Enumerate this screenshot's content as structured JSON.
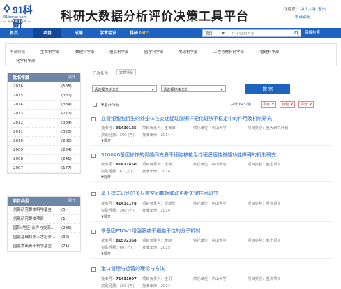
{
  "header": {
    "logo_text": "91科研",
    "logo_url": "91keyan.com",
    "logo_slogan": "一 东离加下品牌 一",
    "site_title": "科研大数据分析评价决策工具平台",
    "welcome": "欢迎您！",
    "user_university": "中山大学",
    "logout": "退出",
    "apply_trial": "申请试用"
  },
  "nav": {
    "items": [
      "首页",
      "项目",
      "成果",
      "学术会议",
      "科研"
    ],
    "brand_suffix": "360°",
    "search_select": "项目",
    "search_placeholder": "共计4244万条",
    "advanced_search": "高级检索"
  },
  "fields": {
    "label": "申请领域：",
    "options": [
      "生命科学部",
      "数理科学部",
      "信息科学部",
      "医学科学部",
      "地球科学部",
      "工程与材料科学部",
      "管理科学部",
      "化学科学部"
    ]
  },
  "sidebar": {
    "year_panel": {
      "title": "批准年度",
      "expand": "展开",
      "rows": [
        {
          "label": "2016",
          "count": "(588)"
        },
        {
          "label": "2015",
          "count": "(330)"
        },
        {
          "label": "2014",
          "count": "(334)"
        },
        {
          "label": "2013",
          "count": "(272)"
        },
        {
          "label": "2012",
          "count": "(334)"
        },
        {
          "label": "2011",
          "count": "(328)"
        },
        {
          "label": "2010",
          "count": "(282)"
        },
        {
          "label": "2009",
          "count": "(254)"
        },
        {
          "label": "2008",
          "count": "(241)"
        },
        {
          "label": "2007",
          "count": "(177)"
        }
      ]
    },
    "type_panel": {
      "title": "项目类型",
      "expand": "展开",
      "rows": [
        {
          "label": "创新研究群体科学基金",
          "count": "(5)"
        },
        {
          "label": "创新研究群体项目",
          "count": "(1)"
        },
        {
          "label": "国际(地区)合作与交流...",
          "count": "(285)"
        },
        {
          "label": "国家基础科学人才培养...",
          "count": "(32)"
        },
        {
          "label": "国家杰出青年科学基金",
          "count": "(71)"
        }
      ]
    }
  },
  "filters": {
    "selected_label": "已选条件:",
    "clear_all": "全部清空",
    "start_year": "请选择开始年份",
    "end_year": "请选择结束年份",
    "search_button": "搜 索"
  },
  "toolbar": {
    "expand_all": "展开所有",
    "total_prefix": "共计:",
    "total_count": "6437",
    "total_suffix": "条",
    "tags": [
      "项目",
      "标题",
      "评分"
    ]
  },
  "results": [
    {
      "title": "血管细胞胞衍生的外泌体在炎症促动脉粥样硬化斑块不稳定中的作用及机制研究",
      "meta1": [
        {
          "k": "批准号：",
          "v": "91439125",
          "bold": true
        },
        {
          "k": "项目负责人：",
          "v": "王赛峰",
          "bold": false
        },
        {
          "k": "依托单位：",
          "v": "中山大学",
          "bold": false
        },
        {
          "k": "项目类别：",
          "v": "重大研究计划",
          "bold": false
        }
      ],
      "meta2": [
        {
          "k": "资助经费：",
          "v": "300 (万)"
        },
        {
          "k": "批准年份：",
          "v": "2014"
        }
      ],
      "expand": "展开"
    },
    {
      "title": "S100A6基因修饰的骨髓间充质干细胞移植治疗硬膜瘘性脊髓功能障碍的机制研究",
      "meta1": [
        {
          "k": "批准号：",
          "v": "81471450",
          "bold": true
        },
        {
          "k": "项目负责人：",
          "v": "张涛",
          "bold": false
        },
        {
          "k": "依托单位：",
          "v": "中山大学",
          "bold": false
        },
        {
          "k": "项目类别：",
          "v": "面上项目",
          "bold": false
        }
      ],
      "meta2": [
        {
          "k": "资助经费：",
          "v": "67 (万)"
        },
        {
          "k": "批准年份：",
          "v": "2014"
        }
      ],
      "expand": "展开"
    },
    {
      "title": "基于模式识别的多尺度空间数据联动更新关键技术研究",
      "meta1": [
        {
          "k": "批准号：",
          "v": "41431178",
          "bold": true
        },
        {
          "k": "项目负责人：",
          "v": "张新长",
          "bold": false
        },
        {
          "k": "依托单位：",
          "v": "中山大学",
          "bold": false
        },
        {
          "k": "项目类别：",
          "v": "重点项目",
          "bold": false
        }
      ],
      "meta2": [
        {
          "k": "资助经费：",
          "v": "300 (万)"
        },
        {
          "k": "批准年份：",
          "v": "2014"
        }
      ],
      "expand": "展开"
    },
    {
      "title": "睾基因PTOV1增强肝癌干细胞干性的分子机制",
      "meta1": [
        {
          "k": "批准号：",
          "v": "81572368",
          "bold": true
        },
        {
          "k": "项目负责人：",
          "v": "黄晓",
          "bold": false
        },
        {
          "k": "依托单位：",
          "v": "中山大学",
          "bold": false
        },
        {
          "k": "项目类别：",
          "v": "面上项目",
          "bold": false
        }
      ],
      "meta2": [
        {
          "k": "资助经费：",
          "v": "60 (万)"
        },
        {
          "k": "批准年份：",
          "v": "2015"
        }
      ],
      "expand": "展开"
    },
    {
      "title": "港口管理与运营的理论与方法",
      "meta1": [
        {
          "k": "批准号：",
          "v": "71431007",
          "bold": true
        },
        {
          "k": "项目负责人：",
          "v": "王机",
          "bold": false
        },
        {
          "k": "依托单位：",
          "v": "中山大学",
          "bold": false
        },
        {
          "k": "项目类别：",
          "v": "重点项目",
          "bold": false
        }
      ],
      "meta2": [
        {
          "k": "资助经费：",
          "v": "260 (万)"
        },
        {
          "k": "批准年份：",
          "v": "2014"
        }
      ],
      "expand": "展开"
    }
  ],
  "colors": {
    "brand_blue": "#1e63c2",
    "nav_active": "#12489a",
    "link_blue": "#1a62c8",
    "side_header": "#6e86a8",
    "tag_red": "#c33"
  }
}
